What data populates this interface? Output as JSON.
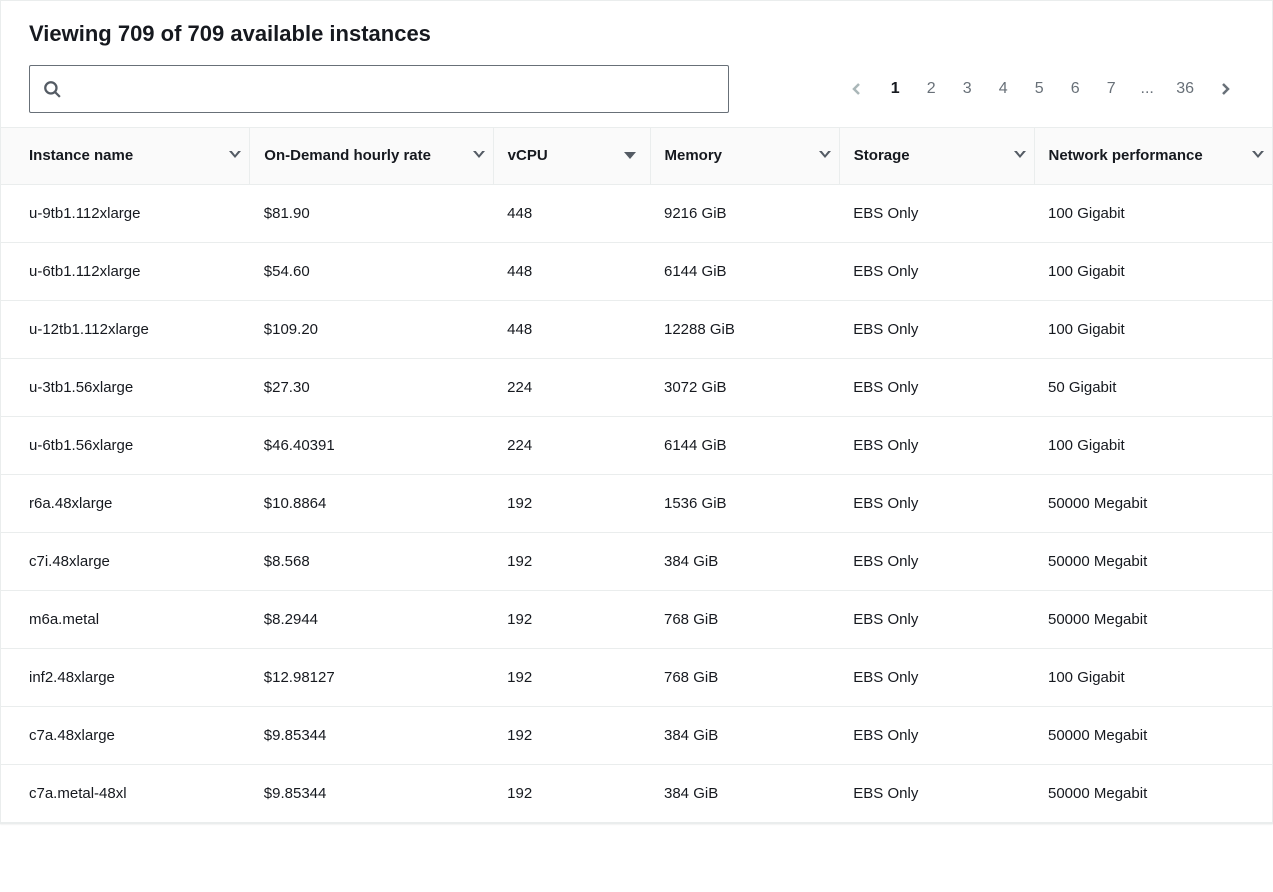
{
  "title": "Viewing 709 of 709 available instances",
  "search": {
    "placeholder": ""
  },
  "pagination": {
    "prevDisabled": true,
    "nextDisabled": false,
    "pages": [
      "1",
      "2",
      "3",
      "4",
      "5",
      "6",
      "7",
      "...",
      "36"
    ],
    "active": "1"
  },
  "columns": [
    {
      "key": "instance_name",
      "label": "Instance name",
      "sorted": false
    },
    {
      "key": "on_demand_rate",
      "label": "On-Demand hourly rate",
      "sorted": false
    },
    {
      "key": "vcpu",
      "label": "vCPU",
      "sorted": true
    },
    {
      "key": "memory",
      "label": "Memory",
      "sorted": false
    },
    {
      "key": "storage",
      "label": "Storage",
      "sorted": false
    },
    {
      "key": "network",
      "label": "Network performance",
      "sorted": false
    }
  ],
  "rows": [
    {
      "instance_name": "u-9tb1.112xlarge",
      "on_demand_rate": "$81.90",
      "vcpu": "448",
      "memory": "9216 GiB",
      "storage": "EBS Only",
      "network": "100 Gigabit"
    },
    {
      "instance_name": "u-6tb1.112xlarge",
      "on_demand_rate": "$54.60",
      "vcpu": "448",
      "memory": "6144 GiB",
      "storage": "EBS Only",
      "network": "100 Gigabit"
    },
    {
      "instance_name": "u-12tb1.112xlarge",
      "on_demand_rate": "$109.20",
      "vcpu": "448",
      "memory": "12288 GiB",
      "storage": "EBS Only",
      "network": "100 Gigabit"
    },
    {
      "instance_name": "u-3tb1.56xlarge",
      "on_demand_rate": "$27.30",
      "vcpu": "224",
      "memory": "3072 GiB",
      "storage": "EBS Only",
      "network": "50 Gigabit"
    },
    {
      "instance_name": "u-6tb1.56xlarge",
      "on_demand_rate": "$46.40391",
      "vcpu": "224",
      "memory": "6144 GiB",
      "storage": "EBS Only",
      "network": "100 Gigabit"
    },
    {
      "instance_name": "r6a.48xlarge",
      "on_demand_rate": "$10.8864",
      "vcpu": "192",
      "memory": "1536 GiB",
      "storage": "EBS Only",
      "network": "50000 Megabit"
    },
    {
      "instance_name": "c7i.48xlarge",
      "on_demand_rate": "$8.568",
      "vcpu": "192",
      "memory": "384 GiB",
      "storage": "EBS Only",
      "network": "50000 Megabit"
    },
    {
      "instance_name": "m6a.metal",
      "on_demand_rate": "$8.2944",
      "vcpu": "192",
      "memory": "768 GiB",
      "storage": "EBS Only",
      "network": "50000 Megabit"
    },
    {
      "instance_name": "inf2.48xlarge",
      "on_demand_rate": "$12.98127",
      "vcpu": "192",
      "memory": "768 GiB",
      "storage": "EBS Only",
      "network": "100 Gigabit"
    },
    {
      "instance_name": "c7a.48xlarge",
      "on_demand_rate": "$9.85344",
      "vcpu": "192",
      "memory": "384 GiB",
      "storage": "EBS Only",
      "network": "50000 Megabit"
    },
    {
      "instance_name": "c7a.metal-48xl",
      "on_demand_rate": "$9.85344",
      "vcpu": "192",
      "memory": "384 GiB",
      "storage": "EBS Only",
      "network": "50000 Megabit"
    }
  ]
}
